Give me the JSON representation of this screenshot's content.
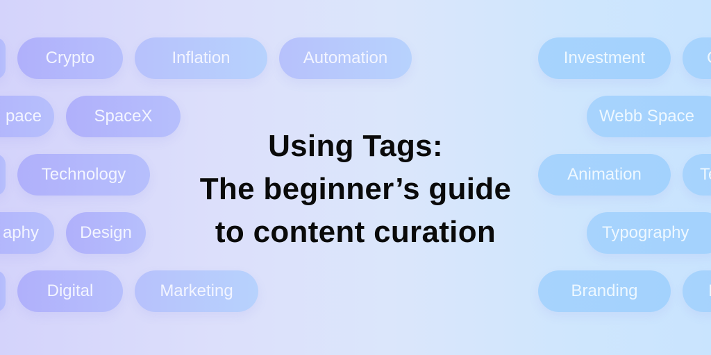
{
  "title": {
    "line1": "Using Tags:",
    "line2": "The beginner’s guide",
    "line3": "to content curation"
  },
  "tags_left": {
    "row1": [
      "",
      "Crypto",
      "Inflation",
      "Automation"
    ],
    "row2": [
      "pace",
      "SpaceX"
    ],
    "row3": [
      "",
      "Technology"
    ],
    "row4": [
      "aphy",
      "Design"
    ],
    "row5": [
      "",
      "Digital",
      "Marketing"
    ]
  },
  "tags_right": {
    "row1": [
      "Investment",
      "C"
    ],
    "row2": [
      "Webb Space"
    ],
    "row3": [
      "Animation",
      "Te"
    ],
    "row4": [
      "Typography"
    ],
    "row5": [
      "Branding",
      "I"
    ]
  },
  "colors": {
    "text": "#0a0a0a",
    "pill_left": "#b0b0fb",
    "pill_right": "#a7d3fd",
    "pill_text": "#f3f5ff"
  }
}
